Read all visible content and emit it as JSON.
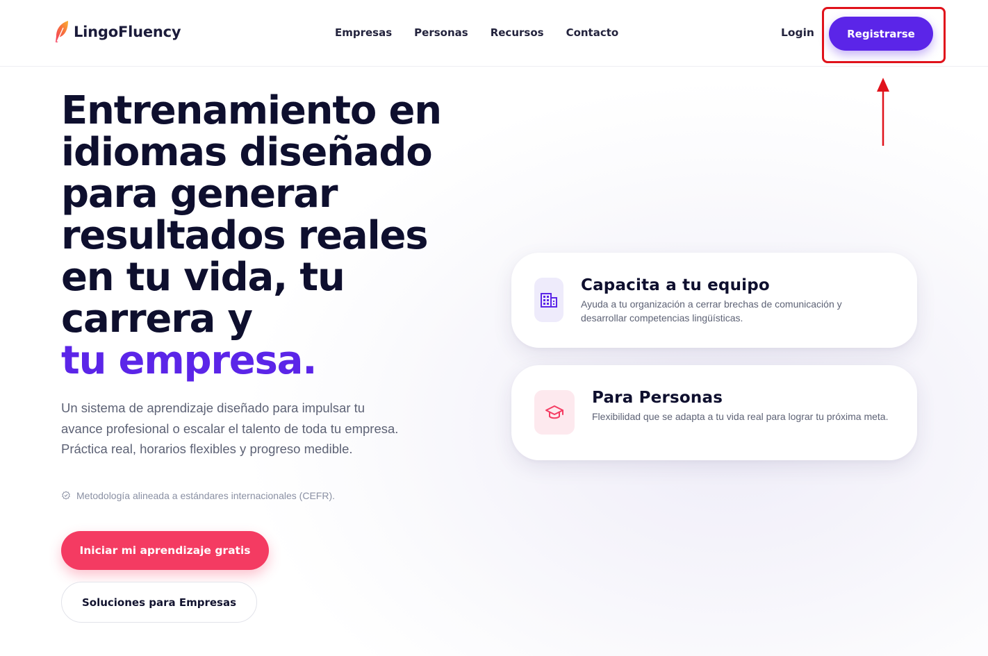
{
  "header": {
    "brand": "LingoFluency",
    "nav": [
      "Empresas",
      "Personas",
      "Recursos",
      "Contacto"
    ],
    "login_label": "Login",
    "register_label": "Registrarse"
  },
  "hero": {
    "title_lines": [
      "Entrenamiento en",
      "idiomas diseñado",
      "para generar",
      "resultados reales",
      "en tu vida, tu",
      "carrera y"
    ],
    "title_accent": "tu empresa.",
    "description": "Un sistema de aprendizaje diseñado para impulsar tu avance profesional o escalar el talento de toda tu empresa. Práctica real, horarios flexibles y progreso medible.",
    "cefr_note": "Metodología alineada a estándares internacionales (CEFR).",
    "cta_primary": "Iniciar mi aprendizaje gratis",
    "cta_secondary": "Soluciones para Empresas"
  },
  "cards": [
    {
      "title": "Capacita a tu equipo",
      "description": "Ayuda a tu organización a cerrar brechas de comunicación y desarrollar competencias lingüísticas.",
      "icon": "building-icon"
    },
    {
      "title": "Para Personas",
      "description": "Flexibilidad que se adapta a tu vida real para lograr tu próxima meta.",
      "icon": "graduation-cap-icon"
    }
  ],
  "colors": {
    "brand_purple": "#5b25e8",
    "cta_pink": "#f43b62",
    "annotation_red": "#e0121b",
    "heading_dark": "#0e0f2e"
  }
}
